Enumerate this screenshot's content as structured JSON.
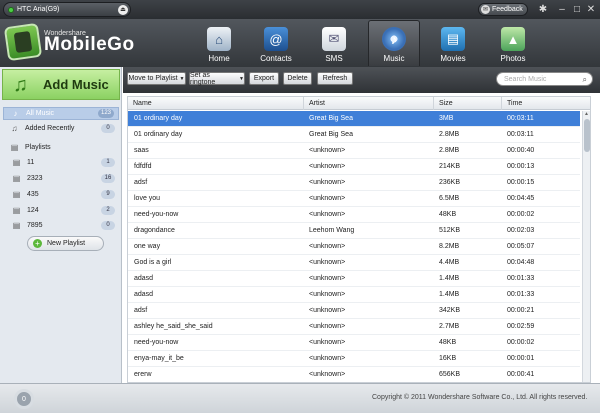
{
  "topbar": {
    "device_name": "HTC Aria(G9)",
    "feedback_label": "Feedback"
  },
  "brand": {
    "company": "Wondershare",
    "product": "MobileGo"
  },
  "nav": [
    {
      "label": "Home",
      "icon": "home-icon"
    },
    {
      "label": "Contacts",
      "icon": "contacts-icon"
    },
    {
      "label": "SMS",
      "icon": "sms-icon"
    },
    {
      "label": "Music",
      "icon": "music-icon",
      "active": true
    },
    {
      "label": "Movies",
      "icon": "movies-icon"
    },
    {
      "label": "Photos",
      "icon": "photos-icon"
    }
  ],
  "sidebar": {
    "add_music": "Add Music",
    "all_music": {
      "label": "All Music",
      "count": "123"
    },
    "added_recently": {
      "label": "Added Recently",
      "count": "0"
    },
    "playlists_label": "Playlists",
    "playlists": [
      {
        "label": "11",
        "count": "1"
      },
      {
        "label": "2323",
        "count": "16"
      },
      {
        "label": "435",
        "count": "9"
      },
      {
        "label": "124",
        "count": "2"
      },
      {
        "label": "7895",
        "count": "0"
      }
    ],
    "new_playlist": "New Playlist"
  },
  "toolbar": {
    "move_to_playlist": "Move to Playlist",
    "set_as_ringtone": "Set as ringtone",
    "export": "Export",
    "delete": "Delete",
    "refresh": "Refresh",
    "search_placeholder": "Search Music"
  },
  "table": {
    "columns": [
      "Name",
      "Artist",
      "Size",
      "Time"
    ],
    "rows": [
      [
        "01 ordinary day",
        "Great Big Sea",
        "3MB",
        "00:03:11"
      ],
      [
        "01 ordinary day",
        "Great Big Sea",
        "2.8MB",
        "00:03:11"
      ],
      [
        "saas",
        "<unknown>",
        "2.8MB",
        "00:00:40"
      ],
      [
        "fdfdfd",
        "<unknown>",
        "214KB",
        "00:00:13"
      ],
      [
        "adsf",
        "<unknown>",
        "236KB",
        "00:00:15"
      ],
      [
        "love you",
        "<unknown>",
        "6.5MB",
        "00:04:45"
      ],
      [
        "need-you-now",
        "<unknown>",
        "48KB",
        "00:00:02"
      ],
      [
        "dragondance",
        "Leehom Wang",
        "512KB",
        "00:02:03"
      ],
      [
        "one way",
        "<unknown>",
        "8.2MB",
        "00:05:07"
      ],
      [
        "God is a girl",
        "<unknown>",
        "4.4MB",
        "00:04:48"
      ],
      [
        "adasd",
        "<unknown>",
        "1.4MB",
        "00:01:33"
      ],
      [
        "adasd",
        "<unknown>",
        "1.4MB",
        "00:01:33"
      ],
      [
        "adsf",
        "<unknown>",
        "342KB",
        "00:00:21"
      ],
      [
        "ashley he_said_she_said",
        "<unknown>",
        "2.7MB",
        "00:02:59"
      ],
      [
        "need-you-now",
        "<unknown>",
        "48KB",
        "00:00:02"
      ],
      [
        "enya-may_it_be",
        "<unknown>",
        "16KB",
        "00:00:01"
      ],
      [
        "ererw",
        "<unknown>",
        "656KB",
        "00:00:41"
      ]
    ]
  },
  "status": {
    "task_count": "0",
    "copyright": "Copyright © 2011 Wondershare Software Co., Ltd. All rights reserved."
  },
  "colors": {
    "selected_row": "#3f7fd8",
    "add_music_green": "#8bd162",
    "header_dark": "#33373b"
  }
}
